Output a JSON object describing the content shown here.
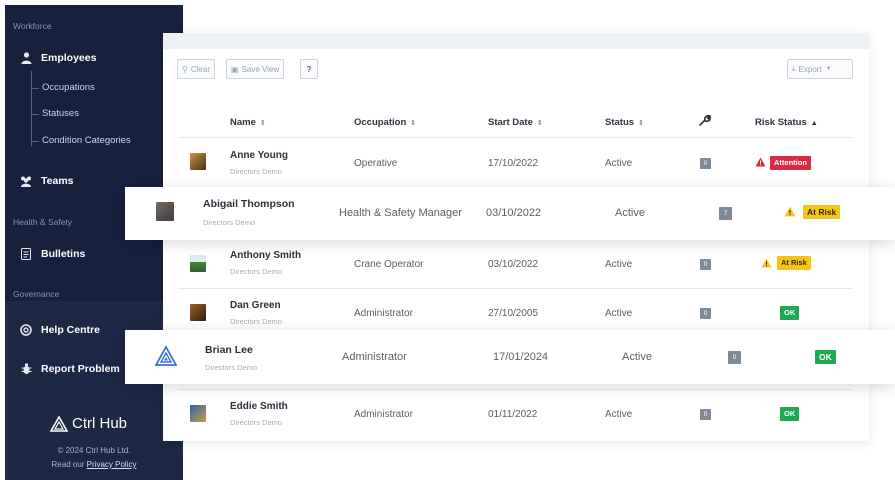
{
  "sidebar": {
    "section_workforce": "Workforce",
    "employees": "Employees",
    "occupations": "Occupations",
    "statuses": "Statuses",
    "condition_categories": "Condition Categories",
    "teams": "Teams",
    "section_health": "Health & Safety",
    "bulletins": "Bulletins",
    "section_governance": "Governance",
    "help_centre": "Help Centre",
    "report_problem": "Report Problem",
    "logo_text": "Ctrl Hub",
    "copyright": "© 2024 Ctrl Hub Ltd.",
    "privacy_prefix": "Read our ",
    "privacy_link": "Privacy Policy"
  },
  "toolbar": {
    "clear": "Clear",
    "save_view": "Save View",
    "help": "?",
    "export": "Export"
  },
  "table": {
    "headers": {
      "name": "Name",
      "occupation": "Occupation",
      "start_date": "Start Date",
      "status": "Status",
      "risk_status": "Risk Status"
    },
    "rows": [
      {
        "name": "Anne Young",
        "sub": "Directors Demo",
        "occupation": "Operative",
        "start": "17/10/2022",
        "status": "Active",
        "count": "0",
        "risk": "Attention"
      },
      {
        "name": "Abigail Thompson",
        "sub": "Directors Demo",
        "occupation": "Health & Safety Manager",
        "start": "03/10/2022",
        "status": "Active",
        "count": "7",
        "risk": "At Risk"
      },
      {
        "name": "Anthony Smith",
        "sub": "Directors Demo",
        "occupation": "Crane Operator",
        "start": "03/10/2022",
        "status": "Active",
        "count": "0",
        "risk": "At Risk"
      },
      {
        "name": "Dan Green",
        "sub": "Directors Demo",
        "occupation": "Administrator",
        "start": "27/10/2005",
        "status": "Active",
        "count": "0",
        "risk": "OK"
      },
      {
        "name": "Brian Lee",
        "sub": "Directors Demo",
        "occupation": "Administrator",
        "start": "17/01/2024",
        "status": "Active",
        "count": "0",
        "risk": "OK"
      },
      {
        "name": "Eddie Smith",
        "sub": "Directors Demo",
        "occupation": "Administrator",
        "start": "01/11/2022",
        "status": "Active",
        "count": "0",
        "risk": "OK"
      }
    ]
  },
  "colors": {
    "sidebar_bg": "#17213d",
    "attention": "#d92c42",
    "at_risk": "#f4c418",
    "ok": "#1eaa52",
    "brian_logo": "#3b6fd8"
  }
}
